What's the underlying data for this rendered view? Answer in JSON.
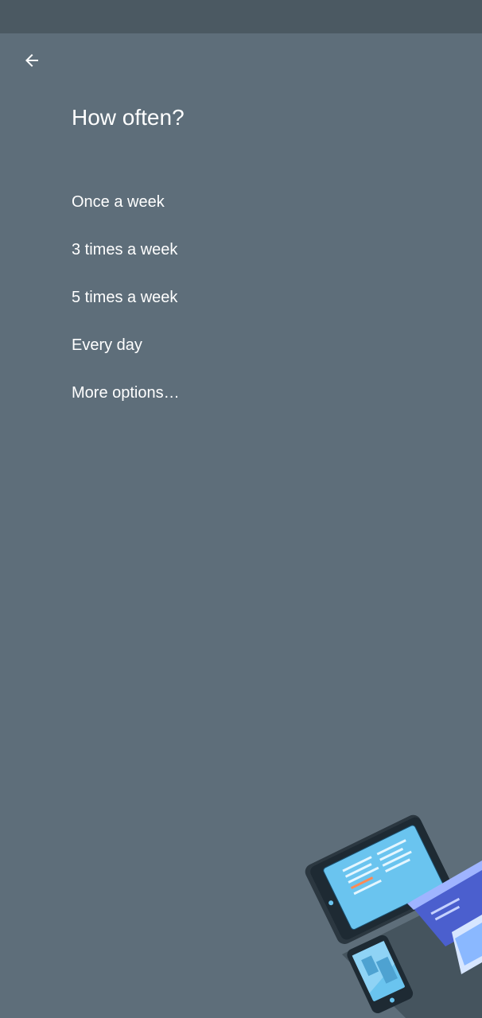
{
  "screen": {
    "title": "How often?",
    "back_icon": "arrow-left-icon"
  },
  "options": [
    {
      "label": "Once a week"
    },
    {
      "label": "3 times a week"
    },
    {
      "label": "5 times a week"
    },
    {
      "label": "Every day"
    },
    {
      "label": "More options…"
    }
  ],
  "colors": {
    "background": "#5e6e7a",
    "status_bar": "#4b5962",
    "text": "#ffffff"
  },
  "illustration": {
    "name": "devices-illustration"
  }
}
